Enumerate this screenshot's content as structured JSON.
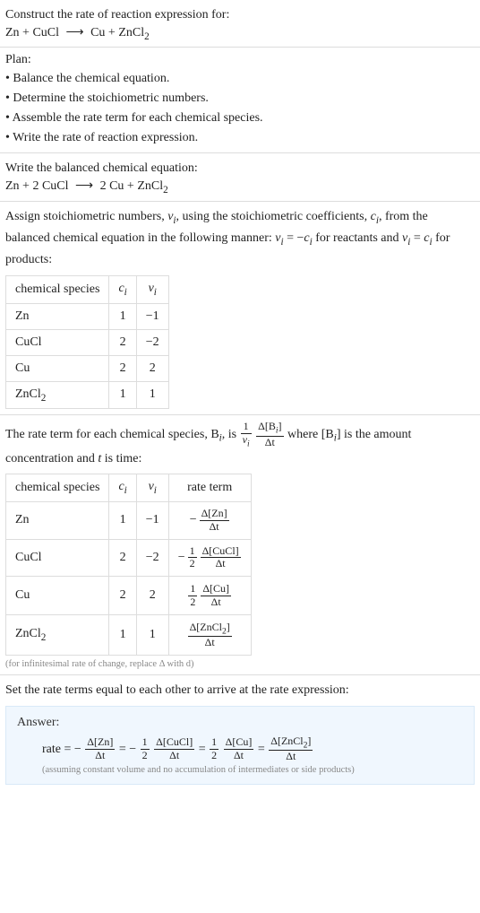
{
  "title": "Construct the rate of reaction expression for:",
  "unbalanced": {
    "lhs": "Zn + CuCl",
    "arrow": "⟶",
    "rhs_pre": "Cu + ZnCl",
    "rhs_sub": "2"
  },
  "plan": {
    "title": "Plan:",
    "items": [
      "Balance the chemical equation.",
      "Determine the stoichiometric numbers.",
      "Assemble the rate term for each chemical species.",
      "Write the rate of reaction expression."
    ]
  },
  "balanced_title": "Write the balanced chemical equation:",
  "balanced": {
    "lhs": "Zn + 2 CuCl",
    "arrow": "⟶",
    "rhs_pre": "2 Cu + ZnCl",
    "rhs_sub": "2"
  },
  "assign_para_parts": {
    "p1": "Assign stoichiometric numbers, ",
    "nu_i": "ν",
    "sub_i": "i",
    "p2": ", using the stoichiometric coefficients, ",
    "c_i": "c",
    "p3": ", from the balanced chemical equation in the following manner: ",
    "formula_reactants_lhs": "ν",
    "formula_reactants_mid": " = −",
    "formula_reactants_rhs": "c",
    "p4": " for reactants and ",
    "formula_products_lhs": "ν",
    "formula_products_mid": " = ",
    "formula_products_rhs": "c",
    "p5": " for products:"
  },
  "stoich_headers": {
    "species": "chemical species",
    "c": "c",
    "nu": "ν",
    "sub_i": "i"
  },
  "stoich_rows": [
    {
      "species": "Zn",
      "c": "1",
      "nu": "−1"
    },
    {
      "species": "CuCl",
      "c": "2",
      "nu": "−2"
    },
    {
      "species": "Cu",
      "c": "2",
      "nu": "2"
    },
    {
      "species_pre": "ZnCl",
      "species_sub": "2",
      "c": "1",
      "nu": "1"
    }
  ],
  "rate_para_parts": {
    "p1": "The rate term for each chemical species, B",
    "sub_i": "i",
    "p2": ", is ",
    "frac1_num": "1",
    "frac1_den_sym": "ν",
    "frac2_num_pre": "Δ[B",
    "frac2_num_post": "]",
    "frac2_den": "Δt",
    "p3": " where [B",
    "p4": "] is the amount concentration and ",
    "t": "t",
    "p5": " is time:"
  },
  "rate_headers": {
    "species": "chemical species",
    "c": "c",
    "nu": "ν",
    "sub_i": "i",
    "rate": "rate term"
  },
  "rate_rows": [
    {
      "species": "Zn",
      "c": "1",
      "nu": "−1",
      "rt_sign": "−",
      "rt_coef_num": "",
      "rt_coef_den": "",
      "rt_num": "Δ[Zn]",
      "rt_den": "Δt"
    },
    {
      "species": "CuCl",
      "c": "2",
      "nu": "−2",
      "rt_sign": "−",
      "rt_coef_num": "1",
      "rt_coef_den": "2",
      "rt_num": "Δ[CuCl]",
      "rt_den": "Δt"
    },
    {
      "species": "Cu",
      "c": "2",
      "nu": "2",
      "rt_sign": "",
      "rt_coef_num": "1",
      "rt_coef_den": "2",
      "rt_num": "Δ[Cu]",
      "rt_den": "Δt"
    },
    {
      "species_pre": "ZnCl",
      "species_sub": "2",
      "c": "1",
      "nu": "1",
      "rt_sign": "",
      "rt_coef_num": "",
      "rt_coef_den": "",
      "rt_num_pre": "Δ[ZnCl",
      "rt_num_sub": "2",
      "rt_num_post": "]",
      "rt_den": "Δt"
    }
  ],
  "infinitesimal_note": "(for infinitesimal rate of change, replace Δ with d)",
  "final_intro": "Set the rate terms equal to each other to arrive at the rate expression:",
  "answer_title": "Answer:",
  "answer_lead": "rate = −",
  "answer_terms": {
    "t1_num": "Δ[Zn]",
    "t1_den": "Δt",
    "eq": " = ",
    "t2_sign": "−",
    "t2_coef_num": "1",
    "t2_coef_den": "2",
    "t2_num": "Δ[CuCl]",
    "t2_den": "Δt",
    "t3_coef_num": "1",
    "t3_coef_den": "2",
    "t3_num": "Δ[Cu]",
    "t3_den": "Δt",
    "t4_num_pre": "Δ[ZnCl",
    "t4_num_sub": "2",
    "t4_num_post": "]",
    "t4_den": "Δt"
  },
  "answer_note": "(assuming constant volume and no accumulation of intermediates or side products)",
  "chart_data": {
    "type": "table",
    "tables": [
      {
        "title": "stoichiometric numbers",
        "columns": [
          "chemical species",
          "c_i",
          "ν_i"
        ],
        "rows": [
          [
            "Zn",
            1,
            -1
          ],
          [
            "CuCl",
            2,
            -2
          ],
          [
            "Cu",
            2,
            2
          ],
          [
            "ZnCl2",
            1,
            1
          ]
        ]
      },
      {
        "title": "rate terms",
        "columns": [
          "chemical species",
          "c_i",
          "ν_i",
          "rate term"
        ],
        "rows": [
          [
            "Zn",
            1,
            -1,
            "-(Δ[Zn]/Δt)"
          ],
          [
            "CuCl",
            2,
            -2,
            "-(1/2)(Δ[CuCl]/Δt)"
          ],
          [
            "Cu",
            2,
            2,
            "(1/2)(Δ[Cu]/Δt)"
          ],
          [
            "ZnCl2",
            1,
            1,
            "(Δ[ZnCl2]/Δt)"
          ]
        ]
      }
    ],
    "rate_expression": "rate = -(Δ[Zn]/Δt) = -(1/2)(Δ[CuCl]/Δt) = (1/2)(Δ[Cu]/Δt) = (Δ[ZnCl2]/Δt)"
  }
}
